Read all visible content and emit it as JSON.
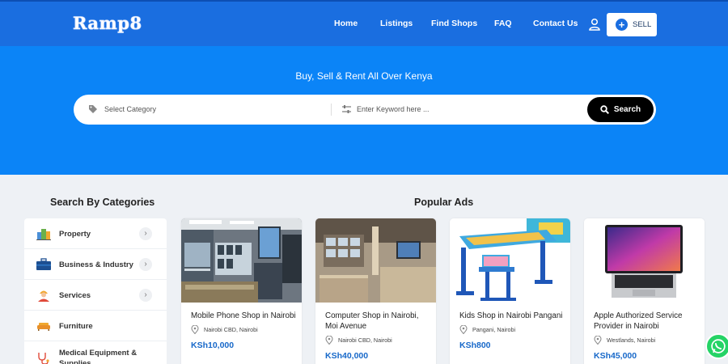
{
  "header": {
    "logo": "Ramp8",
    "nav": [
      "Home",
      "Listings",
      "Find Shops",
      "FAQ",
      "Contact Us"
    ],
    "sell_label": "SELL"
  },
  "hero": {
    "tagline": "Buy, Sell & Rent All Over Kenya",
    "category_placeholder": "Select Category",
    "keyword_placeholder": "Enter Keyword here ...",
    "search_label": "Search"
  },
  "sections": {
    "categories_title": "Search By Categories",
    "popular_title": "Popular Ads"
  },
  "categories": [
    {
      "label": "Property",
      "icon": "buildings-icon"
    },
    {
      "label": "Business & Industry",
      "icon": "briefcase-icon"
    },
    {
      "label": "Services",
      "icon": "worker-icon"
    },
    {
      "label": "Furniture",
      "icon": "sofa-icon"
    },
    {
      "label": "Medical Equipment & Supplies",
      "icon": "stethoscope-icon"
    }
  ],
  "ads": [
    {
      "title": "Mobile Phone Shop in Nairobi",
      "location": "Nairobi CBD, Nairobi",
      "price": "KSh10,000"
    },
    {
      "title": "Computer Shop in Nairobi, Moi Avenue",
      "location": "Nairobi CBD, Nairobi",
      "price": "KSh40,000"
    },
    {
      "title": "Kids Shop in Nairobi Pangani",
      "location": "Pangani, Nairobi",
      "price": "KSh800"
    },
    {
      "title": "Apple Authorized Service Provider in Nairobi",
      "location": "Westlands, Nairobi",
      "price": "KSh45,000"
    }
  ],
  "colors": {
    "brand": "#1a6ee0",
    "hero": "#0b84f7",
    "price": "#1768c9",
    "whatsapp": "#25d366"
  }
}
